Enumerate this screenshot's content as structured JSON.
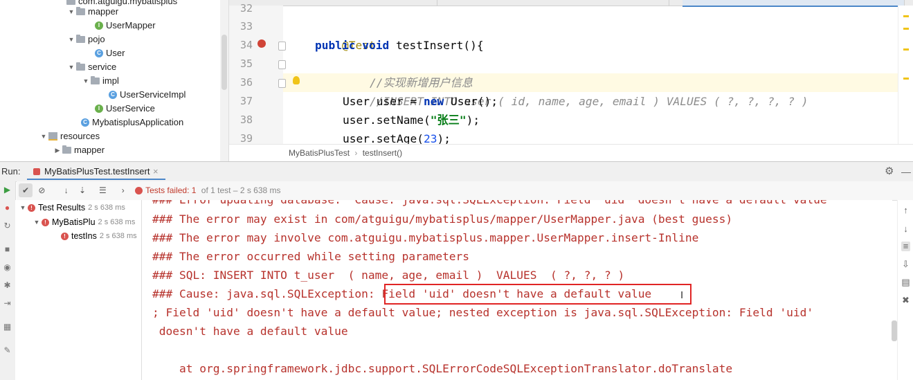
{
  "project_tree": {
    "items": [
      {
        "label": "com.atguigu.mybatisplus",
        "type": "package"
      },
      {
        "label": "mapper",
        "type": "folder"
      },
      {
        "label": "UserMapper",
        "type": "interface"
      },
      {
        "label": "pojo",
        "type": "folder"
      },
      {
        "label": "User",
        "type": "class"
      },
      {
        "label": "service",
        "type": "folder"
      },
      {
        "label": "impl",
        "type": "folder"
      },
      {
        "label": "UserServiceImpl",
        "type": "class"
      },
      {
        "label": "UserService",
        "type": "interface"
      },
      {
        "label": "MybatisplusApplication",
        "type": "class"
      },
      {
        "label": "resources",
        "type": "resources"
      },
      {
        "label": "mapper",
        "type": "folder"
      }
    ]
  },
  "editor": {
    "line_numbers": [
      "32",
      "33",
      "34",
      "35",
      "36",
      "37",
      "38",
      "39"
    ],
    "lines": {
      "l33_annotation": "@Test",
      "l34_public": "public",
      "l34_void": "void",
      "l34_rest": " testInsert(){",
      "l35_comment": "//实现新增用户信息",
      "l36_comment": "//INSERT INTO user ( id, name, age, email ) VALUES ( ?, ?, ?, ? )",
      "l37_a": "User user = ",
      "l37_new": "new",
      "l37_b": " User();",
      "l38_a": "user.setName(",
      "l38_str": "\"张三\"",
      "l38_b": ");",
      "l39_a": "user.setAge(",
      "l39_num": "23",
      "l39_b": ");"
    },
    "breadcrumb": {
      "class_name": "MyBatisPlusTest",
      "separator": "›",
      "method_name": "testInsert()"
    }
  },
  "run_panel": {
    "run_label": "Run:",
    "tab_label": "MyBatisPlusTest.testInsert",
    "tab_close": "×",
    "status": {
      "failed_label": "Tests failed: 1",
      "detail": "of 1 test – 2 s 638 ms"
    },
    "test_tree": [
      {
        "label": "Test Results",
        "time": "2 s 638 ms"
      },
      {
        "label": "MyBatisPlu",
        "time": "2 s 638 ms"
      },
      {
        "label": "testIns",
        "time": "2 s 638 ms"
      }
    ],
    "console_lines": [
      "### Error updating database.  Cause: java.sql.SQLException: Field 'uid' doesn't have a default value",
      "### The error may exist in com/atguigu/mybatisplus/mapper/UserMapper.java (best guess)",
      "### The error may involve com.atguigu.mybatisplus.mapper.UserMapper.insert-Inline",
      "### The error occurred while setting parameters",
      "### SQL: INSERT INTO t_user  ( name, age, email )  VALUES  ( ?, ?, ? )",
      "### Cause: java.sql.SQLException: Field 'uid' doesn't have a default value",
      "; Field 'uid' doesn't have a default value; nested exception is java.sql.SQLException: Field 'uid'",
      " doesn't have a default value",
      "",
      "    at org.springframework.jdbc.support.SQLErrorCodeSQLExceptionTranslator.doTranslate"
    ]
  },
  "colors": {
    "error_text": "#b7322c",
    "highlight_box": "#e02424",
    "keyword": "#0033b3",
    "string": "#067d17"
  }
}
